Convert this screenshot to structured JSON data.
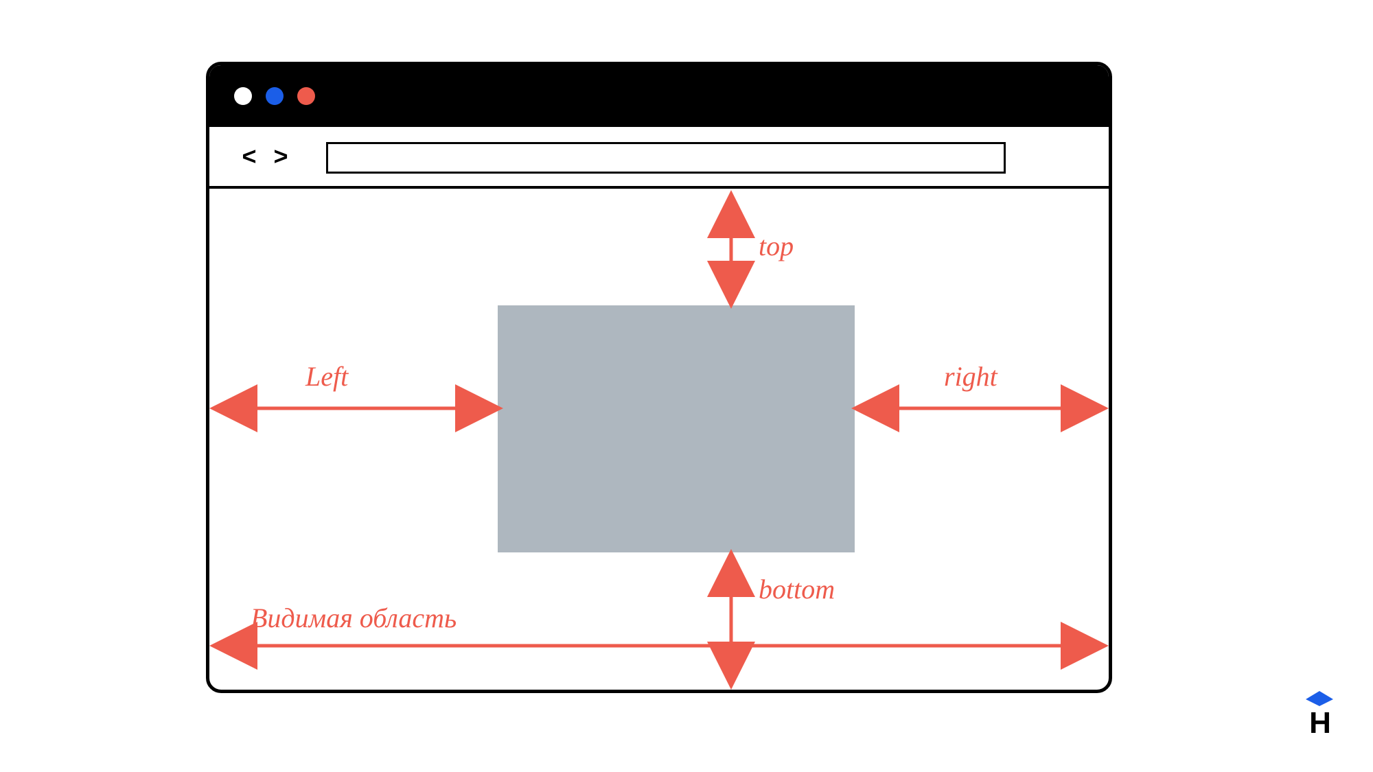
{
  "diagram": {
    "traffic_lights": [
      "white",
      "blue",
      "red"
    ],
    "nav": {
      "back": "<",
      "forward": ">"
    },
    "labels": {
      "top": "top",
      "left": "Left",
      "right": "right",
      "bottom": "bottom",
      "viewport": "Видимая область"
    },
    "colors": {
      "arrow": "#ee5b4c",
      "box": "#aeb7bf",
      "titlebar": "#000000",
      "dot_blue": "#1b5ee8",
      "dot_red": "#ee5b4c"
    }
  },
  "logo": {
    "letter": "H"
  }
}
